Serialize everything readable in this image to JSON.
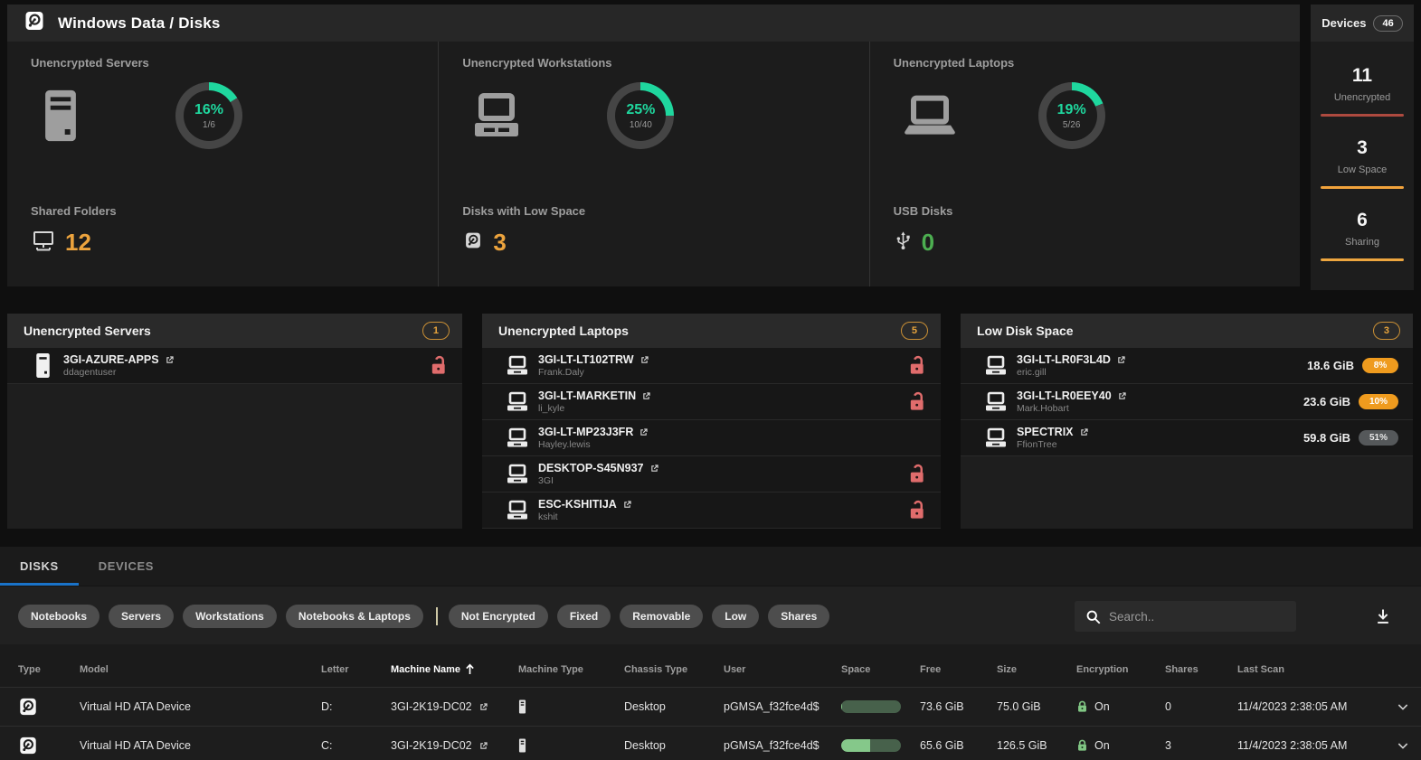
{
  "header": {
    "title": "Windows Data / Disks"
  },
  "colors": {
    "green": "#1fd79e",
    "orange": "#eca33d",
    "usb_green": "#4cae50",
    "red_lock": "#e06c6c",
    "tab_underline": "#1a73c9"
  },
  "devices_panel": {
    "title": "Devices",
    "count": "46",
    "stats": [
      {
        "value": "11",
        "label": "Unencrypted",
        "color": "#ae4a3f"
      },
      {
        "value": "3",
        "label": "Low Space",
        "color": "#f2a33c"
      },
      {
        "value": "6",
        "label": "Sharing",
        "color": "#eda63f"
      }
    ]
  },
  "summary": {
    "donuts": [
      {
        "label": "Unencrypted Servers",
        "icon": "server-icon",
        "pct": "16%",
        "pct_value": 16,
        "fraction": "1/6"
      },
      {
        "label": "Unencrypted Workstations",
        "icon": "workstation-icon",
        "pct": "25%",
        "pct_value": 25,
        "fraction": "10/40"
      },
      {
        "label": "Unencrypted Laptops",
        "icon": "laptop-icon",
        "pct": "19%",
        "pct_value": 19,
        "fraction": "5/26"
      }
    ],
    "counters": [
      {
        "label": "Shared Folders",
        "icon": "shared-folders-icon",
        "value": "12",
        "color": "#eca33d"
      },
      {
        "label": "Disks with Low Space",
        "icon": "disk-icon",
        "value": "3",
        "color": "#eca33d"
      },
      {
        "label": "USB Disks",
        "icon": "usb-icon",
        "value": "0",
        "color": "#4cae50"
      }
    ]
  },
  "panels": [
    {
      "title": "Unencrypted Servers",
      "badge": "1",
      "rows": [
        {
          "name": "3GI-AZURE-APPS",
          "user": "ddagentuser",
          "unencrypted": true
        }
      ]
    },
    {
      "title": "Unencrypted Laptops",
      "badge": "5",
      "rows": [
        {
          "name": "3GI-LT-LT102TRW",
          "user": "Frank.Daly",
          "unencrypted": true
        },
        {
          "name": "3GI-LT-MARKETIN",
          "user": "li_kyle",
          "unencrypted": true
        },
        {
          "name": "3GI-LT-MP23J3FR",
          "user": "Hayley.lewis",
          "unencrypted": false
        },
        {
          "name": "DESKTOP-S45N937",
          "user": "3GI",
          "unencrypted": true
        },
        {
          "name": "ESC-KSHITIJA",
          "user": "kshit",
          "unencrypted": true
        }
      ]
    },
    {
      "title": "Low Disk Space",
      "badge": "3",
      "rows": [
        {
          "name": "3GI-LT-LR0F3L4D",
          "user": "eric.gill",
          "free": "18.6 GiB",
          "pct": "8%",
          "severity": "orange"
        },
        {
          "name": "3GI-LT-LR0EEY40",
          "user": "Mark.Hobart",
          "free": "23.6 GiB",
          "pct": "10%",
          "severity": "orange"
        },
        {
          "name": "SPECTRIX",
          "user": "FfionTree",
          "free": "59.8 GiB",
          "pct": "51%",
          "severity": "gray"
        }
      ]
    }
  ],
  "tabs": [
    {
      "label": "DISKS",
      "active": true
    },
    {
      "label": "DEVICES",
      "active": false
    }
  ],
  "filters": {
    "group1": [
      "Notebooks",
      "Servers",
      "Workstations",
      "Notebooks & Laptops"
    ],
    "group2": [
      "Not Encrypted",
      "Fixed",
      "Removable",
      "Low",
      "Shares"
    ]
  },
  "search": {
    "placeholder": "Search.."
  },
  "table": {
    "columns": [
      "Type",
      "Model",
      "Letter",
      "Machine Name",
      "Machine Type",
      "Chassis Type",
      "User",
      "Space",
      "Free",
      "Size",
      "Encryption",
      "Shares",
      "Last Scan"
    ],
    "sort_column": "Machine Name",
    "sort_direction": "asc",
    "rows": [
      {
        "model": "Virtual HD ATA Device",
        "letter": "D:",
        "machine": "3GI-2K19-DC02",
        "chassis": "Desktop",
        "user": "pGMSA_f32fce4d$",
        "used_pct": 2,
        "free": "73.6 GiB",
        "size": "75.0 GiB",
        "encryption": "On",
        "shares": "0",
        "last_scan": "11/4/2023 2:38:05 AM"
      },
      {
        "model": "Virtual HD ATA Device",
        "letter": "C:",
        "machine": "3GI-2K19-DC02",
        "chassis": "Desktop",
        "user": "pGMSA_f32fce4d$",
        "used_pct": 48,
        "free": "65.6 GiB",
        "size": "126.5 GiB",
        "encryption": "On",
        "shares": "3",
        "last_scan": "11/4/2023 2:38:05 AM"
      }
    ]
  }
}
